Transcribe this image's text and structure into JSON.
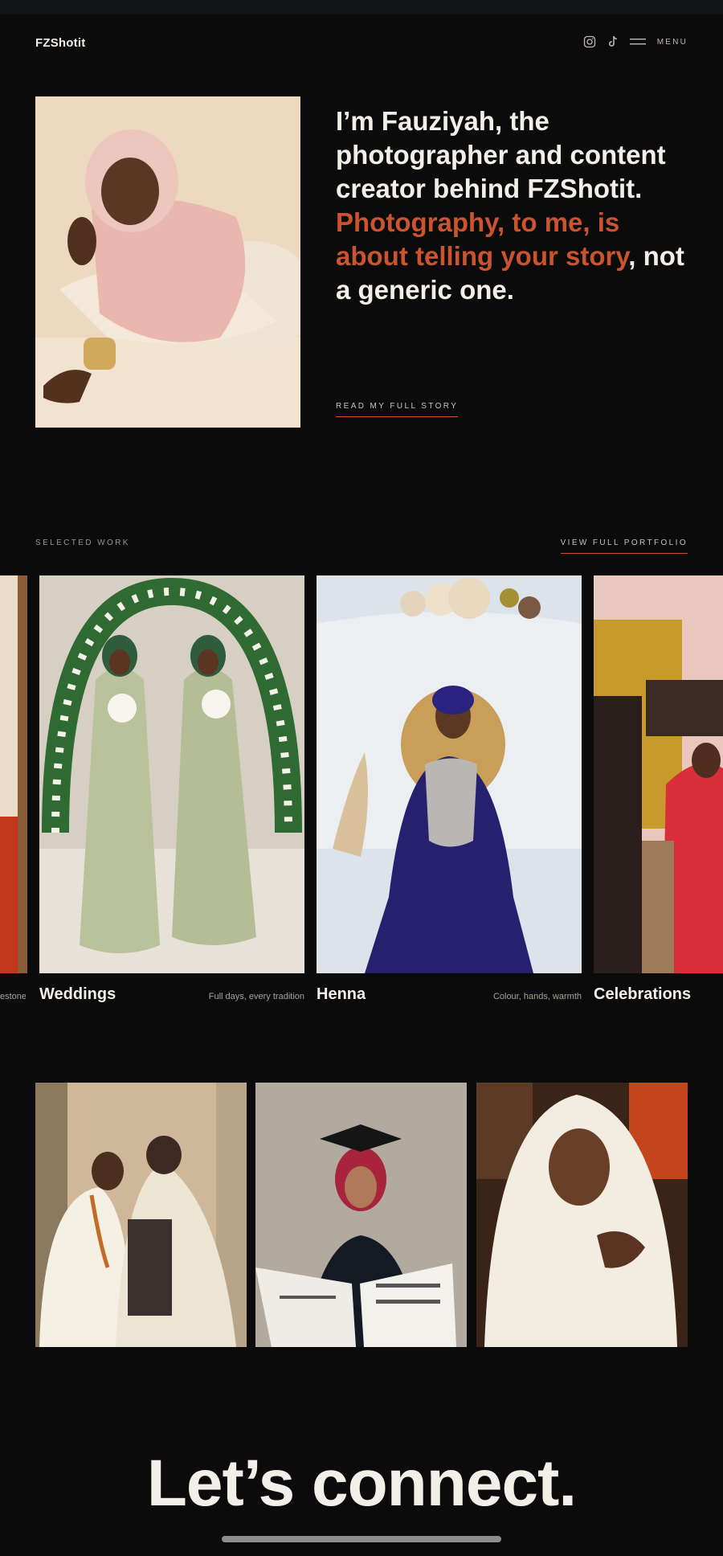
{
  "header": {
    "brand": "FZShotit",
    "menu_label": "MENU",
    "icons": [
      "instagram-icon",
      "tiktok-icon",
      "menu-icon"
    ]
  },
  "intro": {
    "line1": "I’m Fauziyah, the photographer and content creator behind FZShotit.",
    "accent": "Photography, to me, is about telling your story",
    "line2": ", not a generic one.",
    "cta": "READ MY FULL STORY"
  },
  "selected_work": {
    "label": "SELECTED WORK",
    "view_all": "VIEW FULL PORTFOLIO",
    "cards": [
      {
        "title": "",
        "subtitle": "estones"
      },
      {
        "title": "Weddings",
        "subtitle": "Full days, every tradition"
      },
      {
        "title": "Henna",
        "subtitle": "Colour, hands, warmth"
      },
      {
        "title": "Celebrations",
        "subtitle": ""
      }
    ]
  },
  "gallery": {
    "count": 3
  },
  "footer": {
    "headline": "Let’s connect."
  },
  "colors": {
    "background": "#0b0b0b",
    "accent": "#c9542f",
    "text": "#f2efe9"
  }
}
